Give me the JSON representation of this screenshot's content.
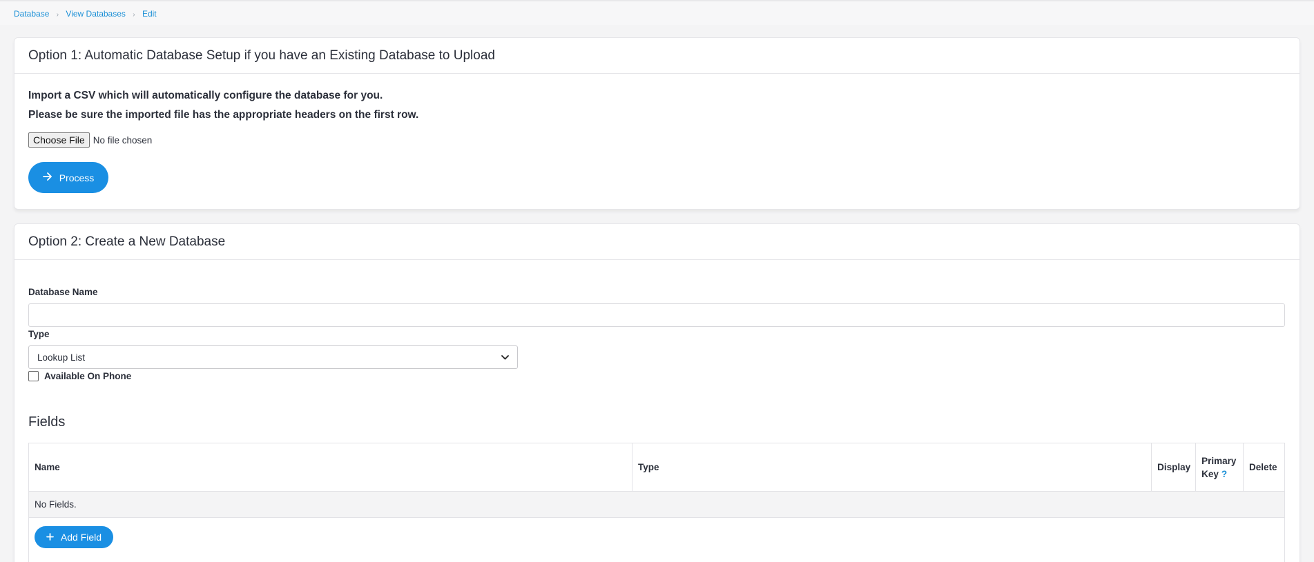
{
  "breadcrumb": {
    "items": [
      "Database",
      "View Databases",
      "Edit"
    ],
    "separator": "›"
  },
  "option1": {
    "title": "Option 1: Automatic Database Setup if you have an Existing Database to Upload",
    "line1": "Import a CSV which will automatically configure the database for you.",
    "line2": "Please be sure the imported file has the appropriate headers on the first row.",
    "file_button": "Choose File",
    "file_status": "No file chosen",
    "process_label": "Process",
    "process_icon": "arrow-right-icon"
  },
  "option2": {
    "title": "Option 2: Create a New Database",
    "name_label": "Database Name",
    "name_value": "",
    "type_label": "Type",
    "type_selected": "Lookup List",
    "phone_label": "Available On Phone",
    "phone_checked": false,
    "fields_title": "Fields",
    "table": {
      "headers": {
        "name": "Name",
        "type": "Type",
        "display": "Display",
        "pk_line1": "Primary",
        "pk_line2": "Key",
        "pk_help": "?",
        "delete": "Delete"
      },
      "empty_text": "No Fields."
    },
    "add_field_label": "Add Field",
    "add_field_icon": "plus-icon"
  },
  "colors": {
    "accent": "#1a8fe3",
    "link": "#1a8fd6",
    "text": "#2b2f3a",
    "background": "#f4f4f5"
  }
}
